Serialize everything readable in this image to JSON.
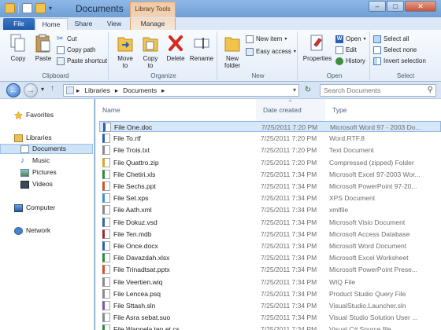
{
  "window": {
    "title": "Documents",
    "context_tab": "Library Tools",
    "controls": {
      "minimize": "–",
      "maximize": "□",
      "close": "✕"
    }
  },
  "ribbon_tabs": [
    "File",
    "Home",
    "Share",
    "View",
    "Manage"
  ],
  "ribbon": {
    "clipboard": {
      "label": "Clipboard",
      "copy": "Copy",
      "paste": "Paste",
      "cut": "Cut",
      "copy_path": "Copy path",
      "paste_shortcut": "Paste shortcut"
    },
    "organize": {
      "label": "Organize",
      "move_to": "Move\nto",
      "copy_to": "Copy\nto",
      "delete": "Delete",
      "rename": "Rename"
    },
    "new": {
      "label": "New",
      "new_folder": "New\nfolder",
      "new_item": "New item",
      "easy_access": "Easy access"
    },
    "open": {
      "label": "Open",
      "properties": "Properties",
      "open": "Open",
      "edit": "Edit",
      "history": "History"
    },
    "select": {
      "label": "Select",
      "select_all": "Select all",
      "select_none": "Select none",
      "invert_selection": "Invert selection"
    }
  },
  "address": {
    "crumbs": [
      "Libraries",
      "Documents"
    ],
    "separator": "▸",
    "search_placeholder": "Search Documents"
  },
  "nav": {
    "favorites": "Favorites",
    "libraries": "Libraries",
    "documents": "Documents",
    "music": "Music",
    "pictures": "Pictures",
    "videos": "Videos",
    "computer": "Computer",
    "network": "Network"
  },
  "columns": {
    "name": "Name",
    "date": "Date created",
    "type": "Type"
  },
  "files": [
    {
      "name": "File One.doc",
      "date": "7/25/2011 7:20 PM",
      "type": "Microsoft Word 97 - 2003 Do...",
      "color": "#2b5fb4"
    },
    {
      "name": "File To.rtf",
      "date": "7/25/2011 7:20 PM",
      "type": "Word.RTF.8",
      "color": "#2b5fb4"
    },
    {
      "name": "File Trois.txt",
      "date": "7/25/2011 7:20 PM",
      "type": "Text Document",
      "color": "#8a8a8a"
    },
    {
      "name": "File Quattro.zip",
      "date": "7/25/2011 7:20 PM",
      "type": "Compressed (zipped) Folder",
      "color": "#d9a72b"
    },
    {
      "name": "File Chetiri.xls",
      "date": "7/25/2011 7:34 PM",
      "type": "Microsoft Excel 97-2003 Wor...",
      "color": "#2e8b3a"
    },
    {
      "name": "File Sechs.ppt",
      "date": "7/25/2011 7:34 PM",
      "type": "Microsoft PowerPoint 97-20...",
      "color": "#d0512a"
    },
    {
      "name": "File Set.xps",
      "date": "7/25/2011 7:34 PM",
      "type": "XPS Document",
      "color": "#3b8fd6"
    },
    {
      "name": "File Aath.xml",
      "date": "7/25/2011 7:34 PM",
      "type": "xmlfile",
      "color": "#8a8a8a"
    },
    {
      "name": "File Dokuz.vsd",
      "date": "7/25/2011 7:34 PM",
      "type": "Microsoft Visio Document",
      "color": "#3366aa"
    },
    {
      "name": "File Ten.mdb",
      "date": "7/25/2011 7:34 PM",
      "type": "Microsoft Access Database",
      "color": "#a1282c"
    },
    {
      "name": "File Once.docx",
      "date": "7/25/2011 7:34 PM",
      "type": "Microsoft Word Document",
      "color": "#2b5fb4"
    },
    {
      "name": "File Davazdah.xlsx",
      "date": "7/25/2011 7:34 PM",
      "type": "Microsoft Excel Worksheet",
      "color": "#2e8b3a"
    },
    {
      "name": "File Trinadtsat.pptx",
      "date": "7/25/2011 7:34 PM",
      "type": "Microsoft PowerPoint Prese...",
      "color": "#d0512a"
    },
    {
      "name": "File Veertien.wiq",
      "date": "7/25/2011 7:34 PM",
      "type": "WIQ File",
      "color": "#8a8a8a"
    },
    {
      "name": "File Lencea.psq",
      "date": "7/25/2011 7:34 PM",
      "type": "Product Studio Query File",
      "color": "#8a8a8a"
    },
    {
      "name": "File Sttash.sln",
      "date": "7/25/2011 7:34 PM",
      "type": "VisualStudio.Launcher.sln",
      "color": "#7a56b0"
    },
    {
      "name": "File Asra sebat.suo",
      "date": "7/25/2011 7:34 PM",
      "type": "Visual Studio Solution User ...",
      "color": "#8a8a8a"
    },
    {
      "name": "File Wanpela ten et.cs",
      "date": "7/25/2011 7:34 PM",
      "type": "Visual C# Source file",
      "color": "#2e8b3a"
    }
  ]
}
